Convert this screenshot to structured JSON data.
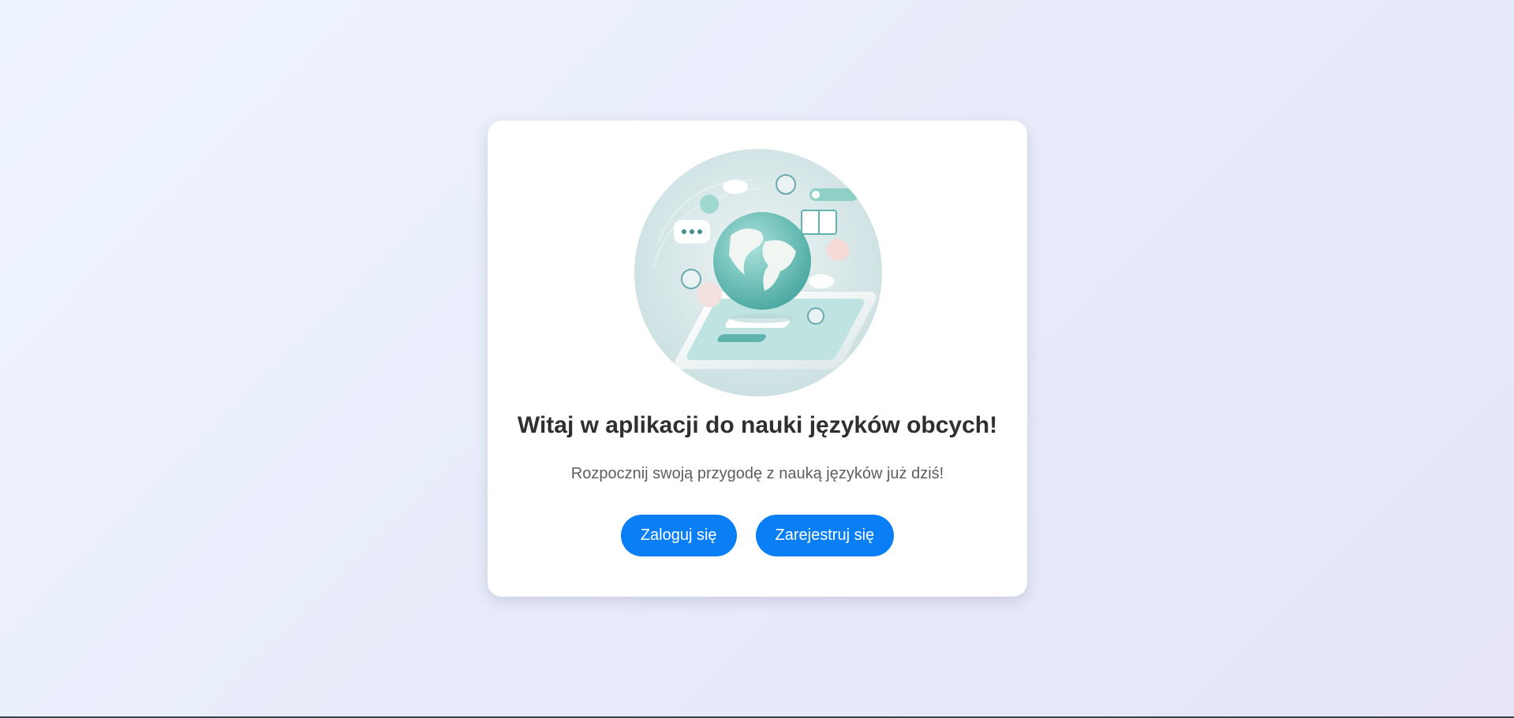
{
  "welcome": {
    "title": "Witaj w aplikacji do nauki języków obcych!",
    "subtitle": "Rozpocznij swoją przygodę z nauką języków już dziś!",
    "hero_image_label": "language-learning-illustration"
  },
  "actions": {
    "login_label": "Zaloguj się",
    "register_label": "Zarejestruj się"
  },
  "colors": {
    "accent": "#0a7ff5",
    "background_start": "#eef4ff",
    "background_end": "#e6e6f8",
    "card": "#ffffff",
    "title_text": "#2f2f2f",
    "subtitle_text": "#5e5e5e"
  }
}
